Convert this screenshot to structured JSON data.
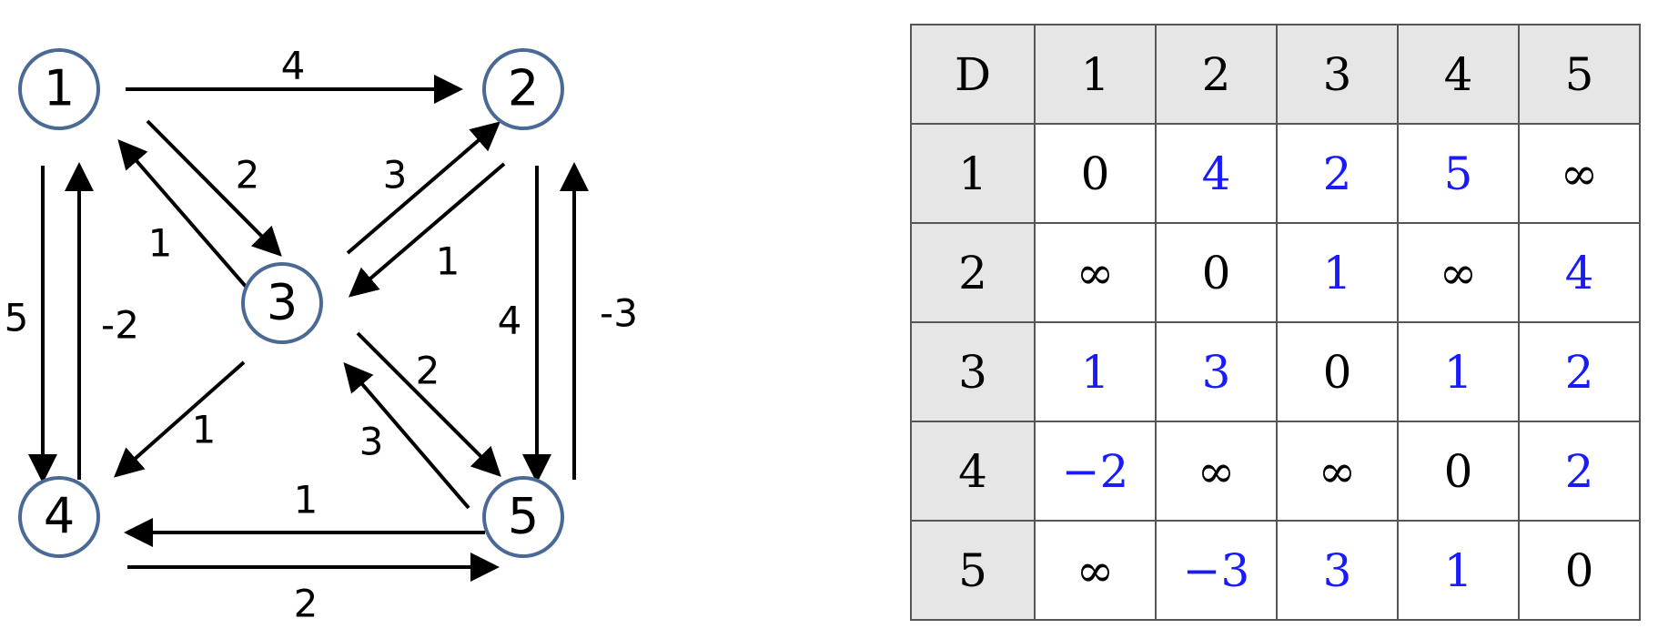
{
  "graph": {
    "nodes": [
      "1",
      "2",
      "3",
      "4",
      "5"
    ],
    "edges": [
      {
        "from": "1",
        "to": "2",
        "weight": "4"
      },
      {
        "from": "1",
        "to": "3",
        "weight": "2"
      },
      {
        "from": "3",
        "to": "1",
        "weight": "1"
      },
      {
        "from": "1",
        "to": "4",
        "weight": "5"
      },
      {
        "from": "4",
        "to": "1",
        "weight": "-2"
      },
      {
        "from": "3",
        "to": "2",
        "weight": "3"
      },
      {
        "from": "2",
        "to": "3",
        "weight": "1"
      },
      {
        "from": "2",
        "to": "5",
        "weight": "4"
      },
      {
        "from": "5",
        "to": "2",
        "weight": "-3"
      },
      {
        "from": "3",
        "to": "4",
        "weight": "1"
      },
      {
        "from": "3",
        "to": "5",
        "weight": "2"
      },
      {
        "from": "5",
        "to": "3",
        "weight": "3"
      },
      {
        "from": "5",
        "to": "4",
        "weight": "1"
      },
      {
        "from": "4",
        "to": "5",
        "weight": "2"
      }
    ],
    "colors": {
      "node_stroke": "#4a6a95",
      "edge": "#000000"
    }
  },
  "table": {
    "corner": "D",
    "columns": [
      "1",
      "2",
      "3",
      "4",
      "5"
    ],
    "rows": [
      {
        "label": "1",
        "cells": [
          {
            "v": "0",
            "hl": false
          },
          {
            "v": "4",
            "hl": true
          },
          {
            "v": "2",
            "hl": true
          },
          {
            "v": "5",
            "hl": true
          },
          {
            "v": "∞",
            "hl": false
          }
        ]
      },
      {
        "label": "2",
        "cells": [
          {
            "v": "∞",
            "hl": false
          },
          {
            "v": "0",
            "hl": false
          },
          {
            "v": "1",
            "hl": true
          },
          {
            "v": "∞",
            "hl": false
          },
          {
            "v": "4",
            "hl": true
          }
        ]
      },
      {
        "label": "3",
        "cells": [
          {
            "v": "1",
            "hl": true
          },
          {
            "v": "3",
            "hl": true
          },
          {
            "v": "0",
            "hl": false
          },
          {
            "v": "1",
            "hl": true
          },
          {
            "v": "2",
            "hl": true
          }
        ]
      },
      {
        "label": "4",
        "cells": [
          {
            "v": "−2",
            "hl": true
          },
          {
            "v": "∞",
            "hl": false
          },
          {
            "v": "∞",
            "hl": false
          },
          {
            "v": "0",
            "hl": false
          },
          {
            "v": "2",
            "hl": true
          }
        ]
      },
      {
        "label": "5",
        "cells": [
          {
            "v": "∞",
            "hl": false
          },
          {
            "v": "−3",
            "hl": true
          },
          {
            "v": "3",
            "hl": true
          },
          {
            "v": "1",
            "hl": true
          },
          {
            "v": "0",
            "hl": false
          }
        ]
      }
    ],
    "colors": {
      "header_bg": "#e6e6e6",
      "highlight": "#1a1aff",
      "normal": "#000000"
    }
  }
}
